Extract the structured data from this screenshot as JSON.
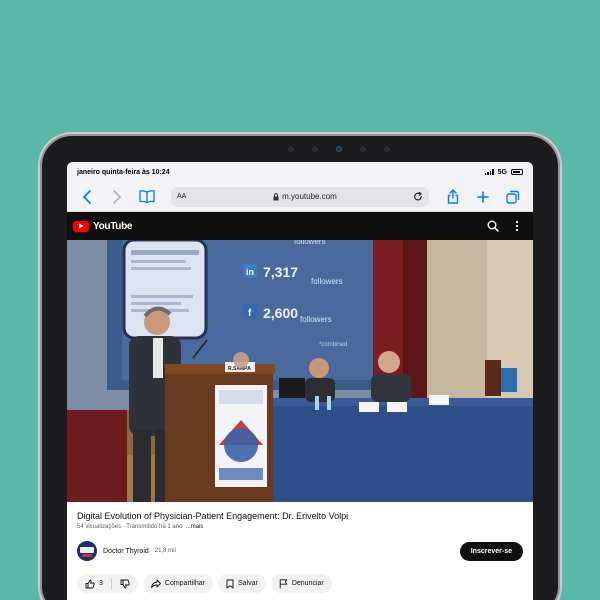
{
  "status_bar": {
    "time": "janeiro quinta-feira às 10:24",
    "network": "5G"
  },
  "browser": {
    "text_size_label": "AA",
    "url": "m.youtube.com",
    "icons": [
      "back-icon",
      "forward-icon",
      "bookmarks-icon",
      "lock-icon",
      "reload-icon",
      "share-icon",
      "new-tab-icon",
      "tabs-icon"
    ]
  },
  "youtube": {
    "logo_text": "YouTube",
    "icons": [
      "search-icon",
      "more-vert-icon"
    ]
  },
  "video": {
    "slide_stats": [
      {
        "network": "in",
        "count": "7,317",
        "label": "followers"
      },
      {
        "network": "f",
        "count": "2,600",
        "label": "followers"
      }
    ],
    "slide_top_word": "followers",
    "slide_footer": "*combined",
    "podium_sign": "R.SAMPA",
    "title": "Digital Evolution of Physician-Patient Engagement: Dr. Erivelto Volpi",
    "views": "54 visualizações",
    "streamed": "Transmitido há 1 ano",
    "more_label": "...mais"
  },
  "channel": {
    "name": "Doctor Thyroid",
    "subscribers": "21,8 mil",
    "subscribe_label": "Inscrever-se"
  },
  "actions": {
    "likes": "3",
    "share_label": "Compartilhar",
    "save_label": "Salvar",
    "report_label": "Denunciar"
  },
  "colors": {
    "background": "#5cb8a6",
    "youtube_red": "#ff0000",
    "safari_blue": "#007aff"
  }
}
